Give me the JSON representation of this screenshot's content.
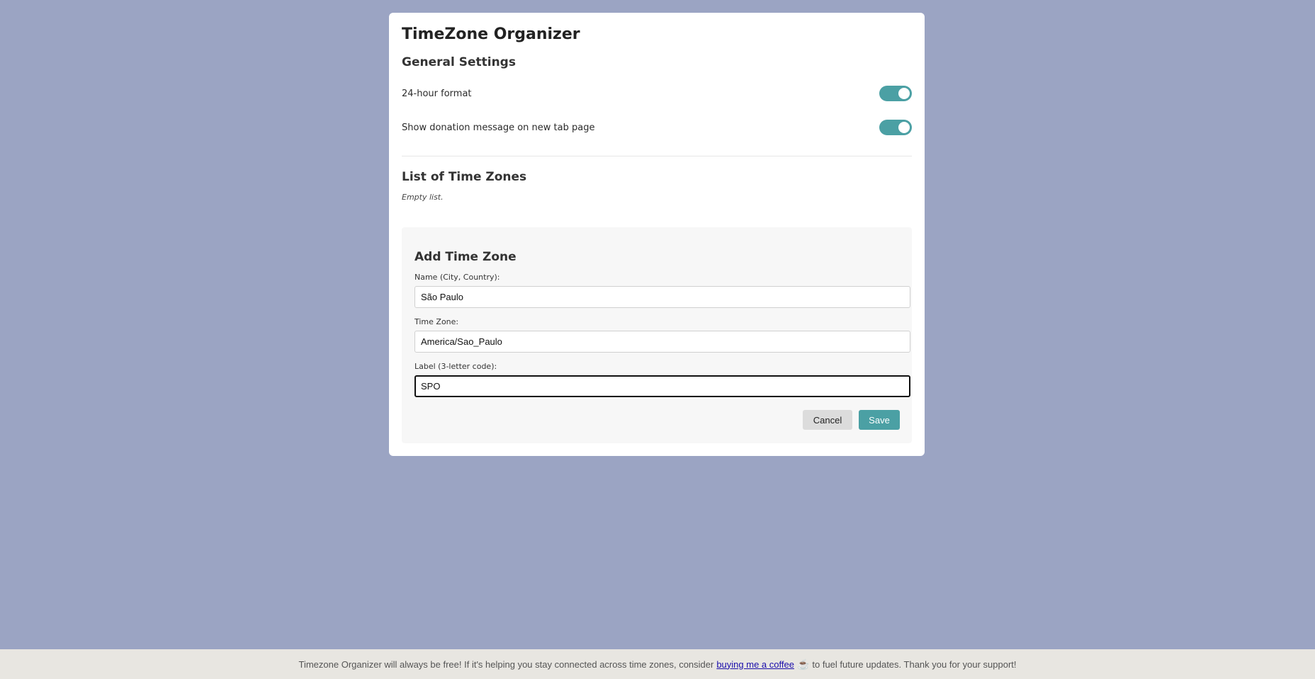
{
  "app": {
    "title": "TimeZone Organizer"
  },
  "general": {
    "title": "General Settings",
    "settings": [
      {
        "label": "24-hour format",
        "enabled": true
      },
      {
        "label": "Show donation message on new tab page",
        "enabled": true
      }
    ]
  },
  "list": {
    "title": "List of Time Zones",
    "empty_text": "Empty list."
  },
  "add_form": {
    "title": "Add Time Zone",
    "name_label": "Name (City, Country):",
    "name_value": "São Paulo",
    "timezone_label": "Time Zone:",
    "timezone_value": "America/Sao_Paulo",
    "code_label": "Label (3-letter code):",
    "code_value": "SPO",
    "cancel_label": "Cancel",
    "save_label": "Save"
  },
  "footer": {
    "text_before": "Timezone Organizer will always be free! If it's helping you stay connected across time zones, consider",
    "link_text": "buying me a coffee",
    "coffee_glyph": "☕",
    "text_after": "to fuel future updates. Thank you for your support!"
  },
  "colors": {
    "background": "#9ba4c3",
    "accent": "#4ba0a4",
    "card": "#ffffff",
    "footer_bg": "#e8e6e1"
  }
}
